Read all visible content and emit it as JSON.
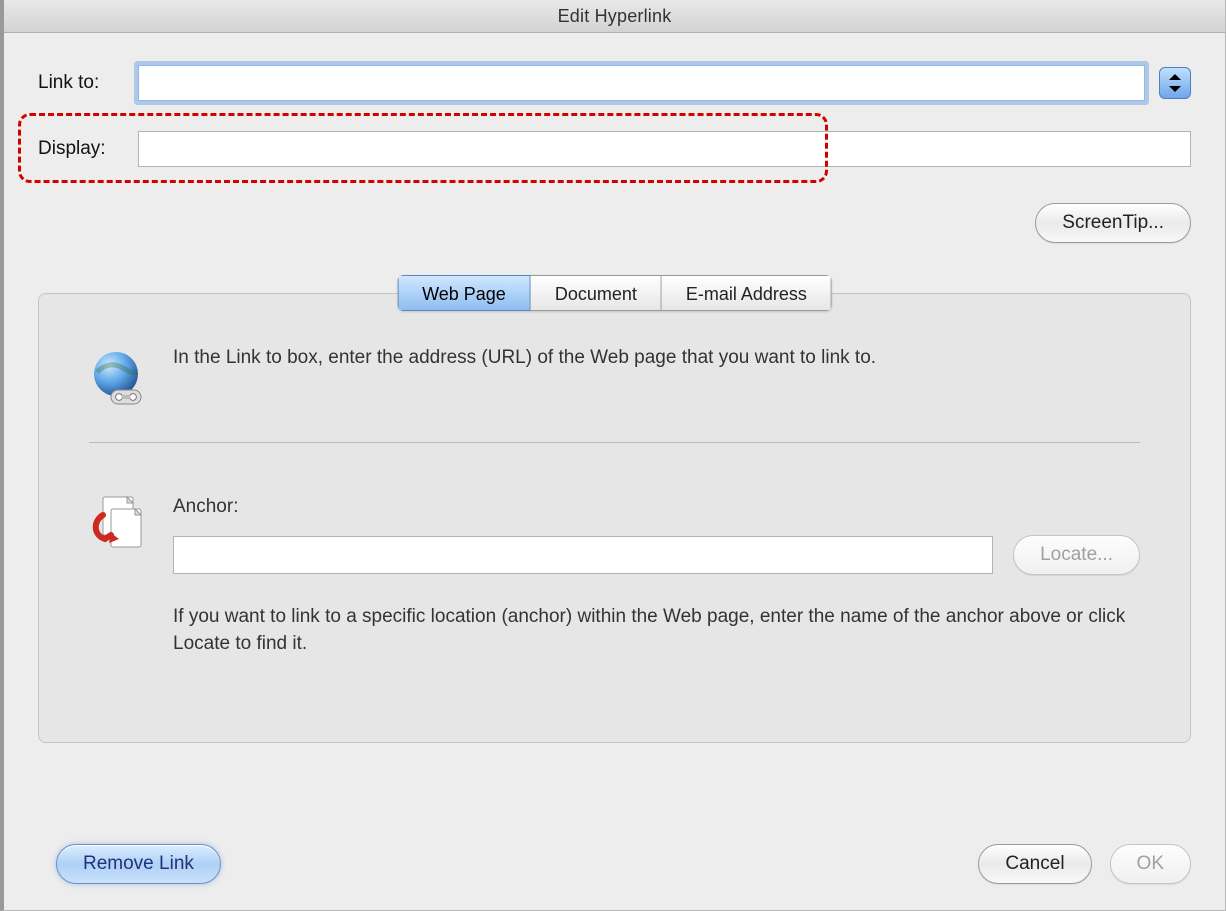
{
  "window": {
    "title": "Edit Hyperlink"
  },
  "linkto": {
    "label": "Link to:",
    "value": ""
  },
  "display": {
    "label": "Display:",
    "value": ""
  },
  "screentip": {
    "label": "ScreenTip..."
  },
  "tabs": {
    "items": [
      {
        "label": "Web Page",
        "active": true
      },
      {
        "label": "Document",
        "active": false
      },
      {
        "label": "E-mail Address",
        "active": false
      }
    ]
  },
  "webpage": {
    "intro": "In the Link to box, enter the address (URL) of the Web page that you want to link to.",
    "anchor_label": "Anchor:",
    "anchor_value": "",
    "locate_label": "Locate...",
    "anchor_help": "If you want to link to a specific location (anchor) within the Web page, enter the name of the anchor above or click Locate to find it."
  },
  "footer": {
    "remove": "Remove Link",
    "cancel": "Cancel",
    "ok": "OK"
  }
}
